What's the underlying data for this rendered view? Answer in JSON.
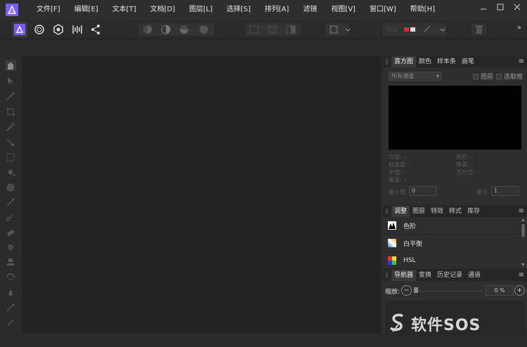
{
  "menubar": {
    "app_icon": "affinity-photo-logo",
    "items": [
      "文件[F]",
      "编辑[E]",
      "文本[T]",
      "文档[D]",
      "图层[L]",
      "选择[S]",
      "排列[A]",
      "滤镜",
      "视图[V]",
      "窗口[W]",
      "帮助[H]"
    ],
    "window_controls": [
      "minimize-icon",
      "maximize-icon",
      "close-icon"
    ]
  },
  "toolbar": {
    "personas": [
      "photo-persona-icon",
      "liquify-persona-icon",
      "develop-persona-icon",
      "tone-mapping-persona-icon",
      "export-persona-icon"
    ],
    "overflow": "»"
  },
  "histogram_panel": {
    "tabs": [
      "直方图",
      "颜色",
      "样本条",
      "画笔"
    ],
    "active_tab": 0,
    "menu": "≡",
    "channel_select": "所有通道",
    "checkbox_layer": "图层",
    "checkbox_selection": "选取框",
    "stats": {
      "mean": "均值: -",
      "std_dev": "标准差: -",
      "median": "中值: -",
      "pixels": "像素: -",
      "level": "色阶: -",
      "count": "像素: -",
      "percentile": "百分位: -"
    },
    "min_label": "最小值",
    "min_value": "0",
    "max_label": "最大",
    "max_value": "1"
  },
  "adjustment_panel": {
    "tabs": [
      "调整",
      "图层",
      "特效",
      "样式",
      "库存"
    ],
    "active_tab": 0,
    "menu": "≡",
    "items": [
      {
        "label": "色阶",
        "icon": "levels-icon"
      },
      {
        "label": "白平衡",
        "icon": "white-balance-icon"
      },
      {
        "label": "HSL",
        "icon": "hsl-icon"
      }
    ]
  },
  "navigator_panel": {
    "tabs": [
      "导航器",
      "变换",
      "历史记录",
      "通道"
    ],
    "active_tab": 0,
    "menu": "≡",
    "zoom_label": "缩放:",
    "zoom_value": "0 %"
  },
  "watermark": {
    "text": "软件SOS"
  },
  "colors": {
    "accent": "#7a5cff",
    "background": "#2b2b2b",
    "canvas": "#232323"
  }
}
